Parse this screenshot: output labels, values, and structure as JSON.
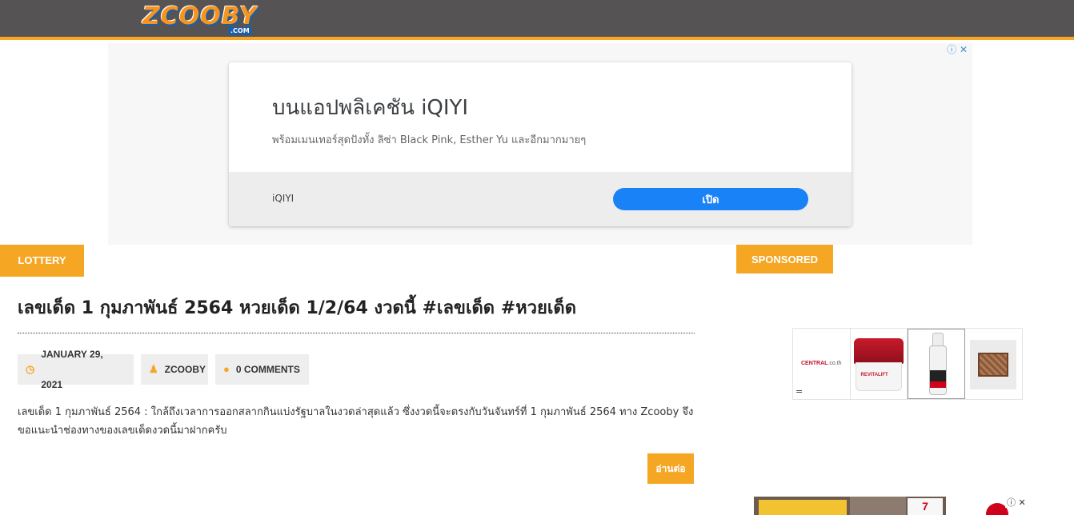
{
  "header": {
    "logo_main": "ZCOOBY",
    "logo_sub": ".COM"
  },
  "top_ad": {
    "controls": "ⓘ ✕",
    "title": "บนแอปพลิเคชัน iQIYI",
    "description": "พร้อมเมนเทอร์สุดปังทั้ง ลิซ่า Black Pink, Esther Yu และอีกมากมายๆ",
    "brand": "iQIYI",
    "cta": "เปิด"
  },
  "category": "LOTTERY",
  "sidebar": {
    "heading": "SPONSORED",
    "shop": {
      "store": "CENTRAL",
      "store_suffix": ".co.th",
      "menu_glyph": "=",
      "jar_label": "REVITALIFT"
    },
    "bottom_banner": {
      "brand_text": "7",
      "controls": "ⓘ ✕"
    }
  },
  "post": {
    "title": "เลขเด็ด 1 กุมภาพันธ์ 2564 หวยเด็ด 1/2/64 งวดนี้ #เลขเด็ด #หวยเด็ด",
    "date": "JANUARY 29, 2021",
    "author": "ZCOOBY",
    "comments": "0 COMMENTS",
    "excerpt": "เลขเด็ด 1 กุมภาพันธ์ 2564 : ใกล้ถึงเวลาการออกสลากกินแบ่งรัฐบาลในงวดล่าสุดแล้ว ซึ่งงวดนี้จะตรงกับวันจันทร์ที่ 1 กุมภาพันธ์ 2564 ทาง Zcooby จึงขอแนะนำช่องทางของเลขเด็ดงวดนี้มาฝากครับ",
    "read_more": "อ่านต่อ"
  },
  "icons": {
    "date": "clock-icon",
    "author": "user-icon",
    "comments": "comment-icon"
  },
  "colors": {
    "accent": "#f5a623",
    "header_bg": "#555354",
    "cta_blue": "#1a82f7"
  }
}
